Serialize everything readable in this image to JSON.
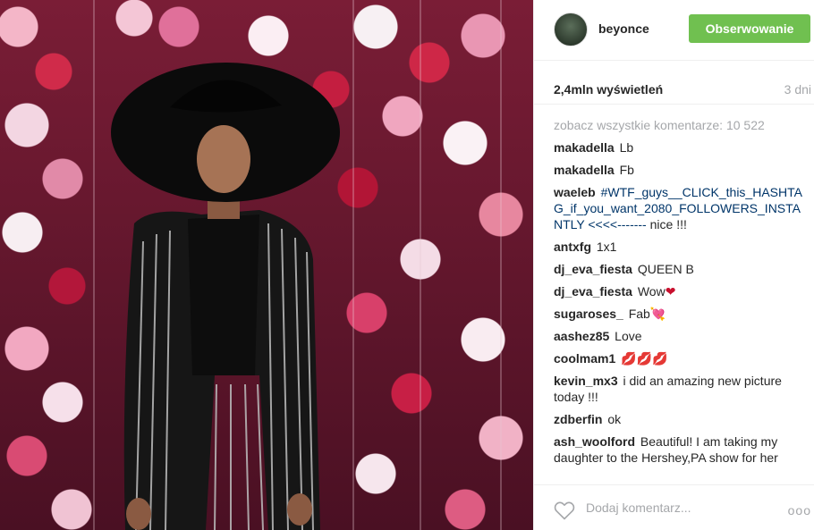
{
  "post": {
    "username": "beyonce",
    "follow_label": "Obserwowanie",
    "views": "2,4mln wyświetleń",
    "age": "3 dni",
    "view_all": "zobacz wszystkie komentarze: 10 522",
    "comments": [
      {
        "user": "makadella",
        "text": "Lb"
      },
      {
        "user": "makadella",
        "text": "Fb"
      },
      {
        "user": "waeleb",
        "text": "nice !!!",
        "hashtag": "#WTF_guys__CLICK_this_HASHTAG_if_you_want_2080_FOLLOWERS_INSTANTLY <<<<-------"
      },
      {
        "user": "antxfg",
        "text": "1x1"
      },
      {
        "user": "dj_eva_fiesta",
        "text": "QUEEN B"
      },
      {
        "user": "dj_eva_fiesta",
        "text": "Wow",
        "emoji": "❤"
      },
      {
        "user": "sugaroses_",
        "text": "Fab",
        "emoji": "💘"
      },
      {
        "user": "aashez85",
        "text": "Love"
      },
      {
        "user": "coolmam1",
        "text": "💋💋💋"
      },
      {
        "user": "kevin_mx3",
        "text": "i did an amazing new picture today !!!"
      },
      {
        "user": "zdberfin",
        "text": "ok"
      },
      {
        "user": "ash_woolford",
        "text": "Beautiful! I am taking my daughter to the Hershey,PA show for her"
      }
    ],
    "add_comment_placeholder": "Dodaj komentarz...",
    "more_label": "ooo"
  },
  "colors": {
    "follow_button": "#70c050",
    "hashtag": "#003569",
    "muted": "#a5a7aa"
  },
  "icons": {
    "like": "heart-outline-icon",
    "more": "ellipsis-icon"
  }
}
